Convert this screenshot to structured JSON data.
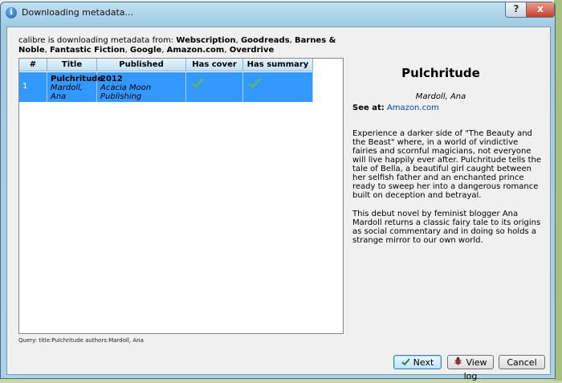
{
  "window": {
    "title": "Downloading metadata...",
    "help_label": "?",
    "close_label": "x"
  },
  "source": {
    "prefix": "calibre is downloading metadata from: ",
    "sources": [
      "Webscription",
      "Goodreads",
      "Barnes & Noble",
      "Fantastic Fiction",
      "Google",
      "Amazon.com",
      "Overdrive"
    ]
  },
  "table": {
    "columns": [
      "#",
      "Title",
      "Published",
      "Has cover",
      "Has summary"
    ],
    "rows": [
      {
        "num": "1",
        "title": "Pulchritude",
        "author": "Mardoll, Ana",
        "year": "2012",
        "publisher": "Acacia Moon Publishing",
        "has_cover": true,
        "has_summary": true
      }
    ]
  },
  "details": {
    "title": "Pulchritude",
    "author": "Mardoll, Ana",
    "see_at_label": "See at:",
    "see_at_link": "Amazon.com",
    "summary": [
      "Experience a darker side of \"The Beauty and the Beast\" where, in a world of vindictive fairies and scornful magicians, not everyone will live happily ever after. Pulchritude tells the tale of Bella, a beautiful girl caught between her selfish father and an enchanted prince ready to sweep her into a dangerous romance built on deception and betrayal.",
      "This debut novel by feminist blogger Ana Mardoll returns a classic fairy tale to its origins as social commentary and in doing so holds a strange mirror to our own world."
    ]
  },
  "query": "Query: title:Pulchritude authors:Mardoll, Ana",
  "buttons": {
    "next": "Next",
    "view_log": "View log",
    "cancel": "Cancel"
  },
  "colors": {
    "selection": "#3399ff",
    "link": "#0645ad"
  }
}
